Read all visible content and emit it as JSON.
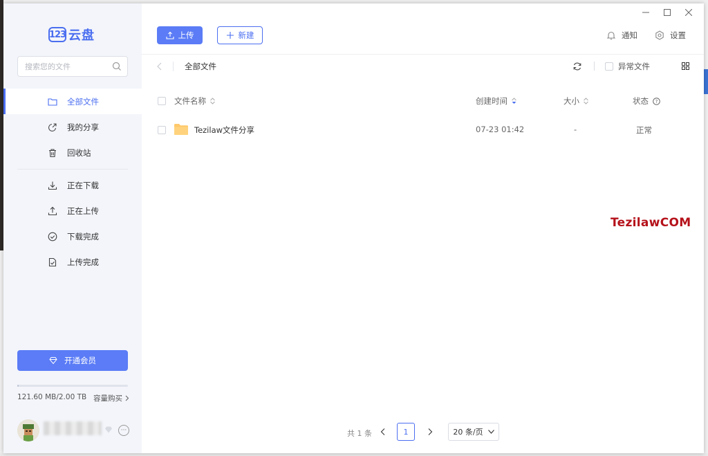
{
  "app": {
    "logo_badge": "123",
    "logo_name": "云盘",
    "brand_color": "#4a6ef0"
  },
  "window_controls": {
    "minimize_icon": "minimize-icon",
    "maximize_icon": "maximize-icon",
    "close_icon": "close-icon"
  },
  "sidebar": {
    "search_placeholder": "搜索您的文件",
    "items": [
      {
        "label": "全部文件",
        "icon": "folder-icon",
        "active": true
      },
      {
        "label": "我的分享",
        "icon": "share-icon"
      },
      {
        "label": "回收站",
        "icon": "trash-icon"
      },
      {
        "label": "正在下载",
        "icon": "download-icon"
      },
      {
        "label": "正在上传",
        "icon": "upload-icon"
      },
      {
        "label": "下载完成",
        "icon": "check-circle-icon"
      },
      {
        "label": "上传完成",
        "icon": "file-check-icon"
      }
    ],
    "vip_label": "开通会员",
    "storage_text": "121.60 MB/2.00 TB",
    "storage_used_fraction": 0.0001,
    "buy_label": "容量购买"
  },
  "toolbar": {
    "upload_label": "上传",
    "new_label": "新建",
    "notify_label": "通知",
    "settings_label": "设置"
  },
  "breadcrumb": {
    "current": "全部文件"
  },
  "filter": {
    "abnormal_label": "异常文件"
  },
  "table": {
    "headers": {
      "name": "文件名称",
      "created": "创建时间",
      "size": "大小",
      "status": "状态"
    },
    "rows": [
      {
        "name": "Tezilaw文件分享",
        "created": "07-23 01:42",
        "size": "-",
        "status": "正常",
        "type": "folder"
      }
    ]
  },
  "watermark": "TezilawCOM",
  "pagination": {
    "total": "共 1 条",
    "current_page": "1",
    "page_size": "20 条/页"
  }
}
